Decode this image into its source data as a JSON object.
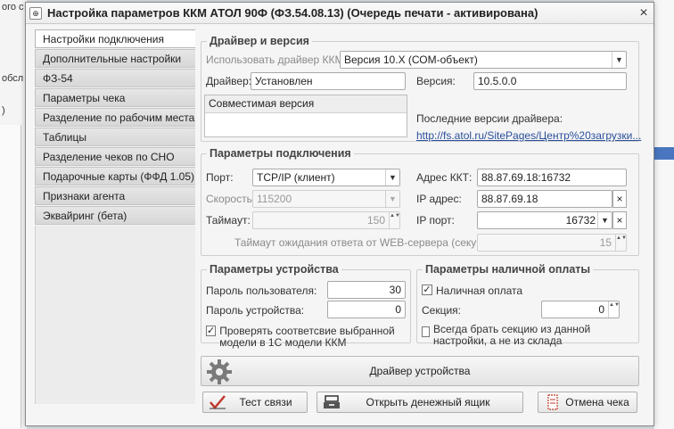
{
  "background": {
    "frag_top": "ого с",
    "frag_left": "обсл",
    "frag_paren": ")"
  },
  "window": {
    "title": "Настройка параметров ККМ АТОЛ 90Ф (ФЗ.54.08.13) (Очередь печати - активирована)",
    "close_glyph": "×"
  },
  "tabs": [
    "Настройки подключения",
    "Дополнительные настройки",
    "ФЗ-54",
    "Параметры чека",
    "Разделение по рабочим местам",
    "Таблицы",
    "Разделение чеков по СНО",
    "Подарочные карты (ФФД 1.05)",
    "Признаки агента",
    "Эквайринг (бета)"
  ],
  "driver": {
    "legend": "Драйвер и версия",
    "use_label": "Использовать драйвер ККМ:",
    "use_value": "Версия 10.Х (СОМ-объект)",
    "driver_label": "Драйвер:",
    "driver_value": "Установлен",
    "version_label": "Версия:",
    "version_value": "10.5.0.0",
    "compat_header": "Совместимая версия",
    "latest_label": "Последние версии драйвера:",
    "latest_link": "http://fs.atol.ru/SitePages/Центр%20загрузки..."
  },
  "connection": {
    "legend": "Параметры подключения",
    "port_label": "Порт:",
    "port_value": "TCP/IP (клиент)",
    "speed_label": "Скорость:",
    "speed_value": "115200",
    "timeout_label": "Таймаут:",
    "timeout_value": "150",
    "kkt_address_label": "Адрес ККТ:",
    "kkt_address_value": "88.87.69.18:16732",
    "ip_label": "IP адрес:",
    "ip_value": "88.87.69.18",
    "ip_port_label": "IP порт:",
    "ip_port_value": "16732",
    "web_timeout_label": "Таймаут ожидания ответа от WEB-сервера (секунд):",
    "web_timeout_value": "15"
  },
  "device": {
    "legend": "Параметры устройства",
    "user_pass_label": "Пароль пользователя:",
    "user_pass_value": "30",
    "device_pass_label": "Пароль устройства:",
    "device_pass_value": "0",
    "check_model_label": "Проверять соответсвие выбранной модели в 1С модели ККМ"
  },
  "cash": {
    "legend": "Параметры наличной оплаты",
    "cash_payment_label": "Наличная оплата",
    "section_label": "Секция:",
    "section_value": "0",
    "always_section_label": "Всегда брать секцию из данной настройки, а не из склада"
  },
  "buttons": {
    "device_driver": "Драйвер устройства",
    "test": "Тест связи",
    "open_drawer": "Открыть денежный ящик",
    "cancel_receipt": "Отмена чека"
  },
  "glyphs": {
    "dropdown": "▼",
    "clear": "×",
    "check": "✓",
    "spin": "▲▼"
  },
  "colors": {
    "link": "#2a4f9c",
    "accent_bar": "#4a76c0"
  }
}
